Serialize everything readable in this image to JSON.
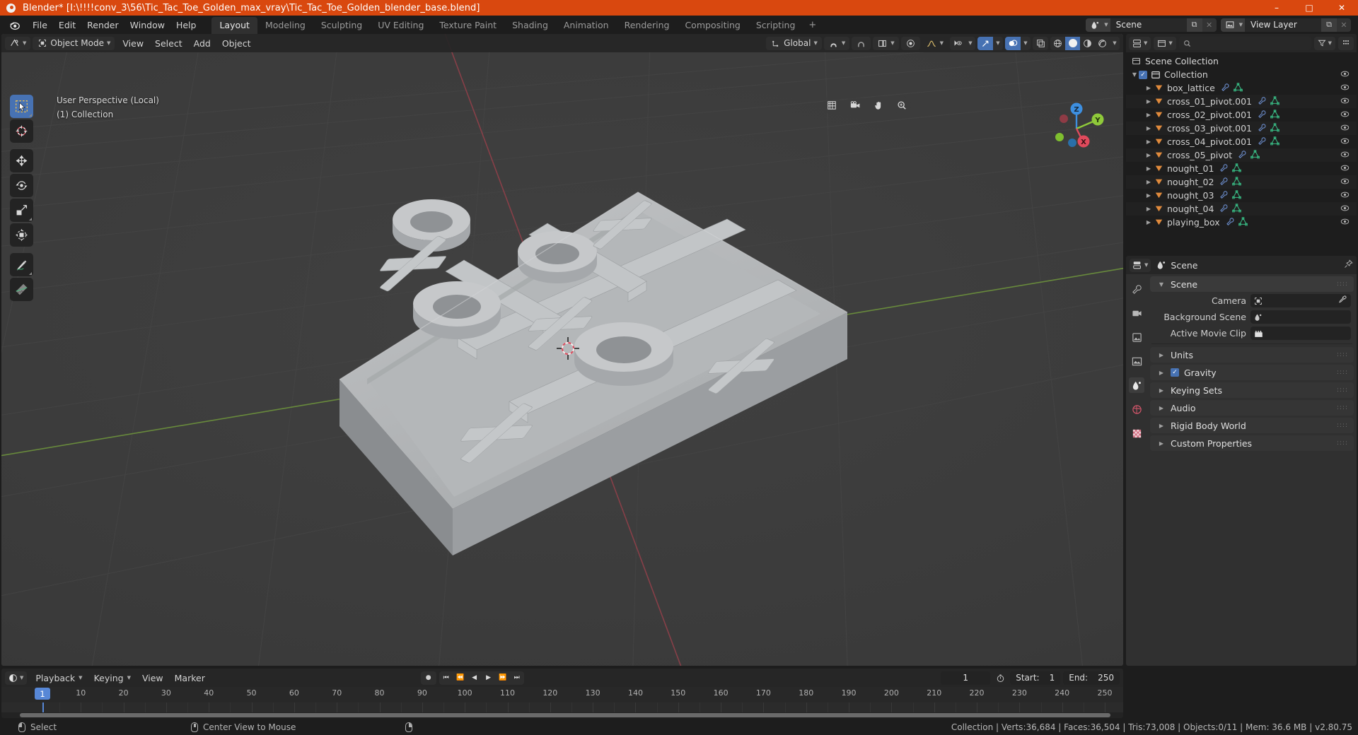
{
  "window": {
    "title": "Blender* [I:\\!!!!conv_3\\56\\Tic_Tac_Toe_Golden_max_vray\\Tic_Tac_Toe_Golden_blender_base.blend]",
    "minimize": "–",
    "maximize": "□",
    "close": "✕"
  },
  "topbar": {
    "menus": [
      "File",
      "Edit",
      "Render",
      "Window",
      "Help"
    ],
    "workspaces": [
      {
        "label": "Layout",
        "active": true
      },
      {
        "label": "Modeling",
        "active": false
      },
      {
        "label": "Sculpting",
        "active": false
      },
      {
        "label": "UV Editing",
        "active": false
      },
      {
        "label": "Texture Paint",
        "active": false
      },
      {
        "label": "Shading",
        "active": false
      },
      {
        "label": "Animation",
        "active": false
      },
      {
        "label": "Rendering",
        "active": false
      },
      {
        "label": "Compositing",
        "active": false
      },
      {
        "label": "Scripting",
        "active": false
      }
    ],
    "workspace_add": "+",
    "scene_name": "Scene",
    "view_layer_name": "View Layer",
    "new_icon": "⧉",
    "unlink_icon": "✕"
  },
  "viewport": {
    "mode": "Object Mode",
    "menus": [
      "View",
      "Select",
      "Add",
      "Object"
    ],
    "transform_orientation": "Global",
    "overlay_line1": "User Perspective (Local)",
    "overlay_line2": "(1) Collection",
    "gizmo_axes": [
      {
        "label": "Z",
        "color": "#3d8fe0"
      },
      {
        "label": "Y",
        "color": "#8fc93a"
      },
      {
        "label": "X",
        "color": "#e04a5c"
      }
    ],
    "nav_icons": [
      "grid-ortho-icon",
      "camera-icon",
      "hand-pan-icon",
      "zoom-icon"
    ],
    "tools": [
      {
        "name": "tweak-select-box",
        "active": true
      },
      {
        "name": "cursor-3d",
        "active": false
      },
      {
        "name": "move",
        "active": false
      },
      {
        "name": "rotate",
        "active": false
      },
      {
        "name": "scale",
        "active": false
      },
      {
        "name": "transform",
        "active": false
      },
      {
        "name": "annotate",
        "active": false
      },
      {
        "name": "measure",
        "active": false
      }
    ],
    "shading_modes": [
      "wireframe",
      "solid",
      "material-preview",
      "rendered"
    ],
    "shading_active": "solid"
  },
  "outliner": {
    "display_mode": "View Layer",
    "search_placeholder": "",
    "root": "Scene Collection",
    "collection": "Collection",
    "items": [
      {
        "name": "box_lattice",
        "modifier": true,
        "mesh": true
      },
      {
        "name": "cross_01_pivot.001",
        "modifier": true,
        "mesh": true
      },
      {
        "name": "cross_02_pivot.001",
        "modifier": true,
        "mesh": true
      },
      {
        "name": "cross_03_pivot.001",
        "modifier": true,
        "mesh": true
      },
      {
        "name": "cross_04_pivot.001",
        "modifier": true,
        "mesh": true
      },
      {
        "name": "cross_05_pivot",
        "modifier": true,
        "mesh": true
      },
      {
        "name": "nought_01",
        "modifier": true,
        "mesh": true
      },
      {
        "name": "nought_02",
        "modifier": true,
        "mesh": true
      },
      {
        "name": "nought_03",
        "modifier": true,
        "mesh": true
      },
      {
        "name": "nought_04",
        "modifier": true,
        "mesh": true
      },
      {
        "name": "playing_box",
        "modifier": true,
        "mesh": true
      }
    ]
  },
  "properties": {
    "breadcrumb": "Scene",
    "panel_title": "Scene",
    "fields": [
      {
        "label": "Camera",
        "value": "",
        "icon": "camera-data-icon",
        "eyedropper": true
      },
      {
        "label": "Background Scene",
        "value": "",
        "icon": "scene-icon",
        "eyedropper": false
      },
      {
        "label": "Active Movie Clip",
        "value": "",
        "icon": "clip-icon",
        "eyedropper": false
      }
    ],
    "sections": [
      {
        "label": "Units",
        "checkbox": false,
        "checked": false
      },
      {
        "label": "Gravity",
        "checkbox": true,
        "checked": true
      },
      {
        "label": "Keying Sets",
        "checkbox": false,
        "checked": false
      },
      {
        "label": "Audio",
        "checkbox": false,
        "checked": false
      },
      {
        "label": "Rigid Body World",
        "checkbox": false,
        "checked": false
      },
      {
        "label": "Custom Properties",
        "checkbox": false,
        "checked": false
      }
    ]
  },
  "timeline": {
    "menus": [
      "Playback",
      "Keying",
      "View",
      "Marker"
    ],
    "current_frame": "1",
    "start_label": "Start:",
    "start_value": "1",
    "end_label": "End:",
    "end_value": "250",
    "ticks": [
      {
        "label": "1",
        "frame": 1,
        "current": true
      },
      {
        "label": "10",
        "frame": 10
      },
      {
        "label": "20",
        "frame": 20
      },
      {
        "label": "30",
        "frame": 30
      },
      {
        "label": "40",
        "frame": 40
      },
      {
        "label": "50",
        "frame": 50
      },
      {
        "label": "60",
        "frame": 60
      },
      {
        "label": "70",
        "frame": 70
      },
      {
        "label": "80",
        "frame": 80
      },
      {
        "label": "90",
        "frame": 90
      },
      {
        "label": "100",
        "frame": 100
      },
      {
        "label": "110",
        "frame": 110
      },
      {
        "label": "120",
        "frame": 120
      },
      {
        "label": "130",
        "frame": 130
      },
      {
        "label": "140",
        "frame": 140
      },
      {
        "label": "150",
        "frame": 150
      },
      {
        "label": "160",
        "frame": 160
      },
      {
        "label": "170",
        "frame": 170
      },
      {
        "label": "180",
        "frame": 180
      },
      {
        "label": "190",
        "frame": 190
      },
      {
        "label": "200",
        "frame": 200
      },
      {
        "label": "210",
        "frame": 210
      },
      {
        "label": "220",
        "frame": 220
      },
      {
        "label": "230",
        "frame": 230
      },
      {
        "label": "240",
        "frame": 240
      },
      {
        "label": "250",
        "frame": 250
      }
    ]
  },
  "statusbar": {
    "left_action": "Select",
    "mid_action": "Center View to Mouse",
    "stats": "Collection | Verts:36,684 | Faces:36,504 | Tris:73,008 | Objects:0/11 | Mem: 36.6 MB | v2.80.75"
  },
  "colors": {
    "accent": "#4772b3",
    "title_bar": "#d9480f",
    "outliner_object": "#e08a3c",
    "mesh_data": "#38b882",
    "modifier": "#6d8fd0"
  }
}
